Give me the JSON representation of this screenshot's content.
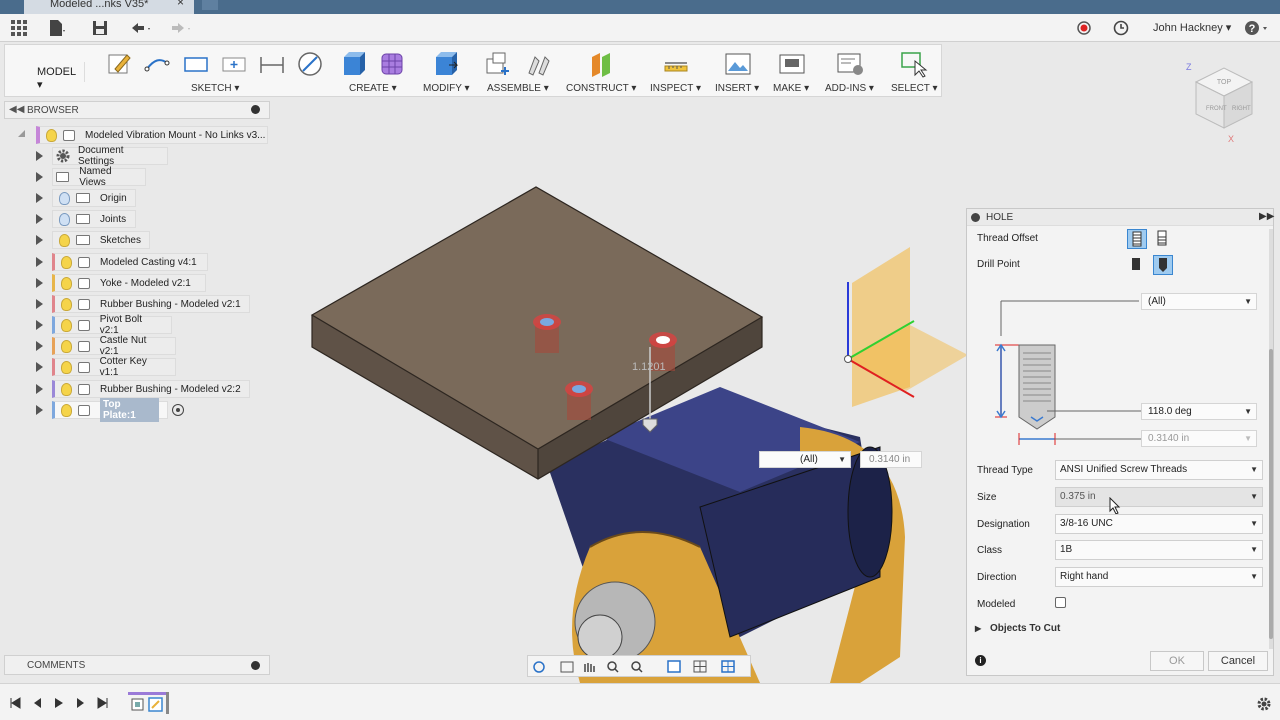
{
  "window": {
    "tab_title": "Modeled ...nks V35*",
    "close_glyph": "×"
  },
  "appbar": {
    "user_name": "John Hackney ▾",
    "help": "?"
  },
  "toolbar": {
    "model_label": "MODEL ▾",
    "groups": {
      "sketch": "SKETCH ▾",
      "create": "CREATE ▾",
      "modify": "MODIFY ▾",
      "assemble": "ASSEMBLE ▾",
      "construct": "CONSTRUCT ▾",
      "inspect": "INSPECT ▾",
      "insert": "INSERT ▾",
      "make": "MAKE ▾",
      "addins": "ADD-INS ▾",
      "select": "SELECT ▾"
    }
  },
  "browser": {
    "title": "BROWSER",
    "root": "Modeled Vibration Mount - No Links v3...",
    "items": [
      {
        "label": "Document Settings"
      },
      {
        "label": "Named Views"
      },
      {
        "label": "Origin"
      },
      {
        "label": "Joints"
      },
      {
        "label": "Sketches"
      },
      {
        "label": "Modeled Casting v4:1"
      },
      {
        "label": "Yoke - Modeled v2:1"
      },
      {
        "label": "Rubber Bushing - Modeled v2:1"
      },
      {
        "label": "Pivot Bolt v2:1"
      },
      {
        "label": "Castle Nut v2:1"
      },
      {
        "label": "Cotter Key v1:1"
      },
      {
        "label": "Rubber Bushing - Modeled v2:2"
      },
      {
        "label": "Top Plate:1"
      }
    ]
  },
  "viewport": {
    "dimension_text": "1.1201",
    "overlay_select": "(All)",
    "overlay_value": "0.3140 in"
  },
  "hole": {
    "title": "HOLE",
    "thread_offset_label": "Thread Offset",
    "drill_point_label": "Drill Point",
    "top_select": "(All)",
    "angle_value": "118.0 deg",
    "diameter_value": "0.3140 in",
    "thread_type_label": "Thread Type",
    "thread_type_value": "ANSI Unified Screw Threads",
    "size_label": "Size",
    "size_value": "0.375 in",
    "designation_label": "Designation",
    "designation_value": "3/8-16 UNC",
    "class_label": "Class",
    "class_value": "1B",
    "direction_label": "Direction",
    "direction_value": "Right hand",
    "modeled_label": "Modeled",
    "objects_to_cut_label": "Objects To Cut",
    "ok_label": "OK",
    "cancel_label": "Cancel"
  },
  "comments": {
    "title": "COMMENTS"
  },
  "viewcube": {
    "top": "TOP",
    "front": "FRONT",
    "right": "RIGHT",
    "z_axis": "Z",
    "x_axis": "X"
  },
  "colors": {
    "accent": "#4a6c8c",
    "plate": "#7a6a5a",
    "yoke": "#2a3060",
    "casting": "#d9a23a",
    "hole_marker": "#e04040"
  }
}
